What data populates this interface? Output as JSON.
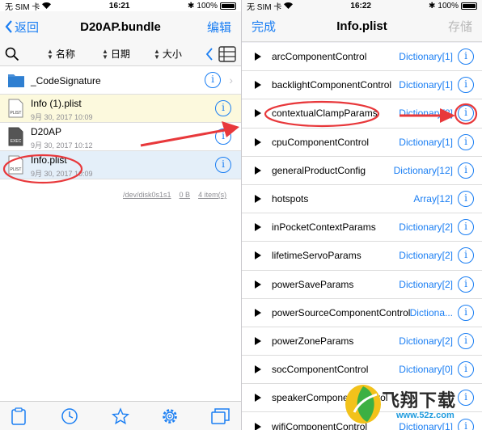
{
  "left": {
    "status": {
      "carrier": "无 SIM 卡",
      "time": "16:21",
      "battery": "100%"
    },
    "nav": {
      "back": "返回",
      "title": "D20AP.bundle",
      "edit": "编辑"
    },
    "sort": {
      "name": "名称",
      "date": "日期",
      "size": "大小"
    },
    "files": [
      {
        "name": "_CodeSignature",
        "date": ""
      },
      {
        "name": "Info (1).plist",
        "date": "9月 30, 2017 10:09",
        "icon_label": "PLIST"
      },
      {
        "name": "D20AP",
        "date": "9月 30, 2017 10:12",
        "icon_label": "EXEC"
      },
      {
        "name": "Info.plist",
        "date": "9月 30, 2017 10:09",
        "icon_label": "PLIST"
      }
    ],
    "footer": {
      "disk": "/dev/disk0s1s1",
      "size": "0 B",
      "items": "4 item(s)"
    }
  },
  "right": {
    "status": {
      "carrier": "无 SIM 卡",
      "time": "16:22",
      "battery": "100%"
    },
    "nav": {
      "done": "完成",
      "title": "Info.plist",
      "save": "存储"
    },
    "rows": [
      {
        "key": "arcComponentControl",
        "type": "Dictionary[1]"
      },
      {
        "key": "backlightComponentControl",
        "type": "Dictionary[1]"
      },
      {
        "key": "contextualClampParams",
        "type": "Dictionary[8]"
      },
      {
        "key": "cpuComponentControl",
        "type": "Dictionary[1]"
      },
      {
        "key": "generalProductConfig",
        "type": "Dictionary[12]"
      },
      {
        "key": "hotspots",
        "type": "Array[12]"
      },
      {
        "key": "inPocketContextParams",
        "type": "Dictionary[2]"
      },
      {
        "key": "lifetimeServoParams",
        "type": "Dictionary[2]"
      },
      {
        "key": "powerSaveParams",
        "type": "Dictionary[2]"
      },
      {
        "key": "powerSourceComponentControl",
        "type": "Dictiona..."
      },
      {
        "key": "powerZoneParams",
        "type": "Dictionary[2]"
      },
      {
        "key": "socComponentControl",
        "type": "Dictionary[0]"
      },
      {
        "key": "speakerComponentControl",
        "type": ""
      },
      {
        "key": "wifiComponentControl",
        "type": "Dictionary[1]"
      }
    ]
  },
  "watermark": {
    "text": "飞翔下载",
    "url": "www.52z.com"
  },
  "colors": {
    "accent": "#1a7ef3",
    "annotation": "#e8383b",
    "selected_bg": "#e4eff9",
    "highlight_bg": "#fcf9dd"
  }
}
